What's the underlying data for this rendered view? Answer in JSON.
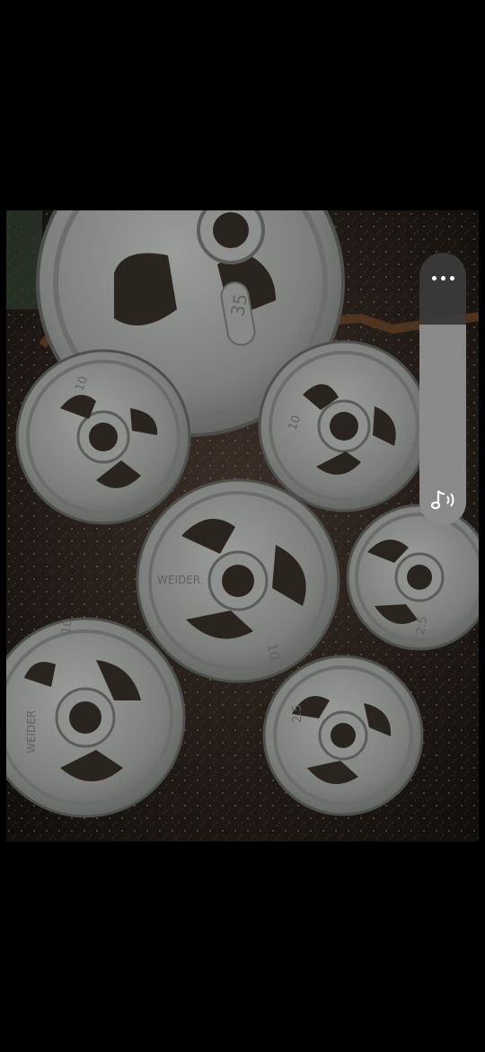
{
  "photo": {
    "alt": "Weider cast iron weight plates on rubber gym floor",
    "plates": [
      {
        "id": "plate-35",
        "label": "35"
      },
      {
        "id": "plate-10-left",
        "label": "10"
      },
      {
        "id": "plate-10-right",
        "label": "10"
      },
      {
        "id": "plate-10-center",
        "label": "10",
        "brand": "WEIDER"
      },
      {
        "id": "plate-25-right",
        "label": "2.5"
      },
      {
        "id": "plate-10-bottom-left",
        "label": "10",
        "brand": "WEIDER"
      },
      {
        "id": "plate-25-bottom",
        "label": "2.5"
      }
    ]
  },
  "controls": {
    "more_icon": "more-horizontal-icon",
    "sound_icon": "music-note-sound-icon",
    "volume_level": 1.0,
    "track_color": "#8a8a8a",
    "panel_color": "#3c3c3c"
  }
}
